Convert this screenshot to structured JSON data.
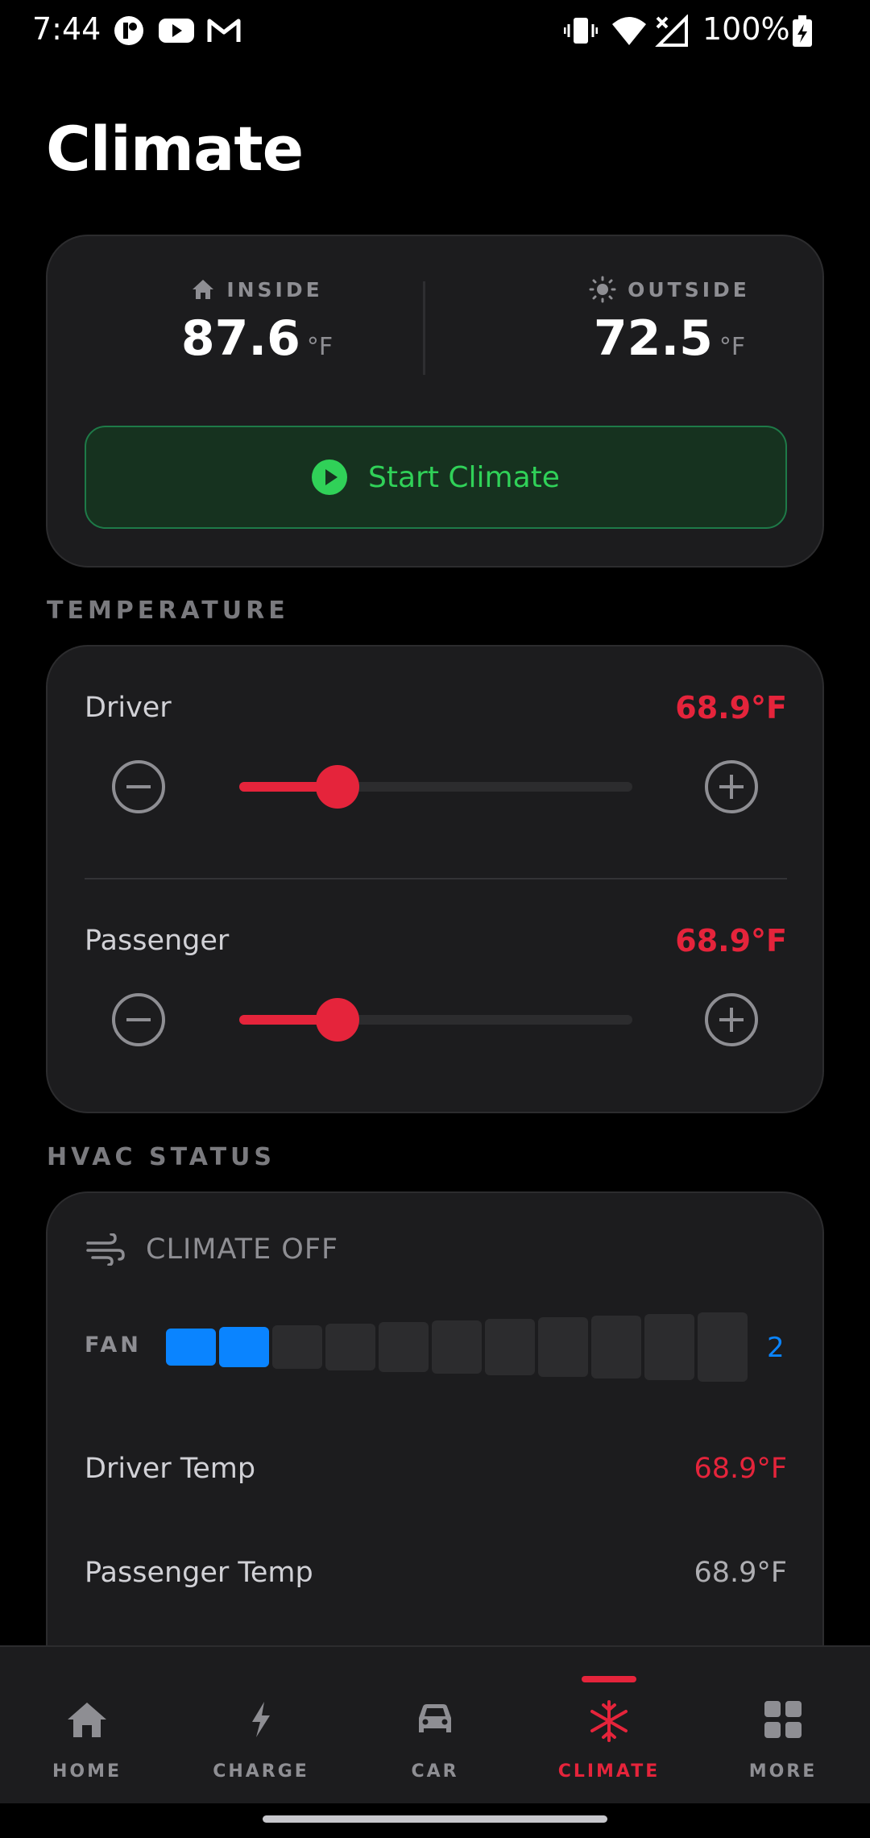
{
  "status_bar": {
    "time": "7:44",
    "battery": "100%",
    "icons": [
      "app-icon",
      "youtube-icon",
      "gmail-icon",
      "vibrate-icon",
      "wifi-icon",
      "no-signal-icon",
      "battery-charging-icon"
    ]
  },
  "title": "Climate",
  "environment": {
    "inside": {
      "label": "INSIDE",
      "value": "87.6",
      "unit": "°F",
      "icon": "home-icon"
    },
    "outside": {
      "label": "OUTSIDE",
      "value": "72.5",
      "unit": "°F",
      "icon": "sun-icon"
    },
    "start_button": "Start Climate"
  },
  "temperature": {
    "section_title": "TEMPERATURE",
    "rows": [
      {
        "label": "Driver",
        "value": "68.9°F",
        "slider_fraction": 0.25
      },
      {
        "label": "Passenger",
        "value": "68.9°F",
        "slider_fraction": 0.25
      }
    ]
  },
  "hvac": {
    "section_title": "HVAC STATUS",
    "state": "CLIMATE OFF",
    "fan_label": "FAN",
    "fan_level": 2,
    "fan_max": 11,
    "fan_value": "2",
    "driver_temp_label": "Driver Temp",
    "driver_temp_value": "68.9°F",
    "passenger_temp_label": "Passenger Temp",
    "passenger_temp_value": "68.9°F"
  },
  "nav": {
    "items": [
      {
        "label": "HOME",
        "icon": "home-icon"
      },
      {
        "label": "CHARGE",
        "icon": "bolt-icon"
      },
      {
        "label": "CAR",
        "icon": "car-icon"
      },
      {
        "label": "CLIMATE",
        "icon": "snowflake-icon"
      },
      {
        "label": "MORE",
        "icon": "grid-icon"
      }
    ],
    "active": "CLIMATE"
  },
  "colors": {
    "accent_red": "#e5243b",
    "green": "#30d158",
    "blue": "#0a84ff",
    "card": "#1c1c1e"
  }
}
